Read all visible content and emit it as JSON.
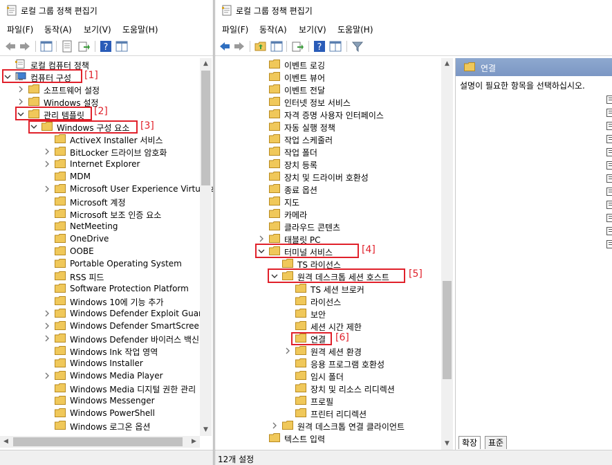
{
  "left_window": {
    "title": "로컬 그룹 정책 편집기",
    "menu": [
      "파일(F)",
      "동작(A)",
      "보기(V)",
      "도움말(H)"
    ],
    "tree": [
      {
        "label": "로컬 컴퓨터 정책",
        "level": 0,
        "arrow": "",
        "icon": "policy"
      },
      {
        "label": "컴퓨터 구성",
        "level": 0,
        "arrow": "down",
        "icon": "computer"
      },
      {
        "label": "소프트웨어 설정",
        "level": 1,
        "arrow": "right",
        "icon": "folder"
      },
      {
        "label": "Windows 설정",
        "level": 1,
        "arrow": "right",
        "icon": "folder"
      },
      {
        "label": "관리 템플릿",
        "level": 1,
        "arrow": "down",
        "icon": "folder"
      },
      {
        "label": "Windows 구성 요소",
        "level": 2,
        "arrow": "down",
        "icon": "folder"
      },
      {
        "label": "ActiveX Installer 서비스",
        "level": 3,
        "arrow": "",
        "icon": "folder"
      },
      {
        "label": "BitLocker 드라이브 암호화",
        "level": 3,
        "arrow": "right",
        "icon": "folder"
      },
      {
        "label": "Internet Explorer",
        "level": 3,
        "arrow": "right",
        "icon": "folder"
      },
      {
        "label": "MDM",
        "level": 3,
        "arrow": "",
        "icon": "folder"
      },
      {
        "label": "Microsoft User Experience Virtualiz",
        "level": 3,
        "arrow": "right",
        "icon": "folder"
      },
      {
        "label": "Microsoft 계정",
        "level": 3,
        "arrow": "",
        "icon": "folder"
      },
      {
        "label": "Microsoft 보조 인증 요소",
        "level": 3,
        "arrow": "",
        "icon": "folder"
      },
      {
        "label": "NetMeeting",
        "level": 3,
        "arrow": "",
        "icon": "folder"
      },
      {
        "label": "OneDrive",
        "level": 3,
        "arrow": "",
        "icon": "folder"
      },
      {
        "label": "OOBE",
        "level": 3,
        "arrow": "",
        "icon": "folder"
      },
      {
        "label": "Portable Operating System",
        "level": 3,
        "arrow": "",
        "icon": "folder"
      },
      {
        "label": "RSS 피드",
        "level": 3,
        "arrow": "",
        "icon": "folder"
      },
      {
        "label": "Software Protection Platform",
        "level": 3,
        "arrow": "",
        "icon": "folder"
      },
      {
        "label": "Windows 10에 기능 추가",
        "level": 3,
        "arrow": "",
        "icon": "folder"
      },
      {
        "label": "Windows Defender Exploit Guard",
        "level": 3,
        "arrow": "right",
        "icon": "folder"
      },
      {
        "label": "Windows Defender SmartScreen",
        "level": 3,
        "arrow": "right",
        "icon": "folder"
      },
      {
        "label": "Windows Defender 바이러스 백신",
        "level": 3,
        "arrow": "right",
        "icon": "folder"
      },
      {
        "label": "Windows Ink 작업 영역",
        "level": 3,
        "arrow": "",
        "icon": "folder"
      },
      {
        "label": "Windows Installer",
        "level": 3,
        "arrow": "",
        "icon": "folder"
      },
      {
        "label": "Windows Media Player",
        "level": 3,
        "arrow": "right",
        "icon": "folder"
      },
      {
        "label": "Windows Media 디지털 권한 관리",
        "level": 3,
        "arrow": "",
        "icon": "folder"
      },
      {
        "label": "Windows Messenger",
        "level": 3,
        "arrow": "",
        "icon": "folder"
      },
      {
        "label": "Windows PowerShell",
        "level": 3,
        "arrow": "",
        "icon": "folder"
      },
      {
        "label": "Windows 로그온 옵션",
        "level": 3,
        "arrow": "",
        "icon": "folder"
      }
    ],
    "markers": [
      "[1]",
      "[2]",
      "[3]"
    ]
  },
  "right_window": {
    "title": "로컬 그룹 정책 편집기",
    "menu": [
      "파일(F)",
      "동작(A)",
      "보기(V)",
      "도움말(H)"
    ],
    "tree": [
      {
        "label": "이벤트 로깅",
        "level": 0,
        "arrow": ""
      },
      {
        "label": "이벤트 뷰어",
        "level": 0,
        "arrow": ""
      },
      {
        "label": "이벤트 전달",
        "level": 0,
        "arrow": ""
      },
      {
        "label": "인터넷 정보 서비스",
        "level": 0,
        "arrow": ""
      },
      {
        "label": "자격 증명 사용자 인터페이스",
        "level": 0,
        "arrow": ""
      },
      {
        "label": "자동 실행 정책",
        "level": 0,
        "arrow": ""
      },
      {
        "label": "작업 스케줄러",
        "level": 0,
        "arrow": ""
      },
      {
        "label": "작업 폴더",
        "level": 0,
        "arrow": ""
      },
      {
        "label": "장치 등록",
        "level": 0,
        "arrow": ""
      },
      {
        "label": "장치 및 드라이버 호환성",
        "level": 0,
        "arrow": ""
      },
      {
        "label": "종료 옵션",
        "level": 0,
        "arrow": ""
      },
      {
        "label": "지도",
        "level": 0,
        "arrow": ""
      },
      {
        "label": "카메라",
        "level": 0,
        "arrow": ""
      },
      {
        "label": "클라우드 콘텐츠",
        "level": 0,
        "arrow": ""
      },
      {
        "label": "태블릿 PC",
        "level": 0,
        "arrow": "right"
      },
      {
        "label": "터미널 서비스",
        "level": 0,
        "arrow": "down"
      },
      {
        "label": "TS 라이선스",
        "level": 1,
        "arrow": ""
      },
      {
        "label": "원격 데스크톱 세션 호스트",
        "level": 1,
        "arrow": "down"
      },
      {
        "label": "TS 세션 브로커",
        "level": 2,
        "arrow": ""
      },
      {
        "label": "라이선스",
        "level": 2,
        "arrow": ""
      },
      {
        "label": "보안",
        "level": 2,
        "arrow": ""
      },
      {
        "label": "세션 시간 제한",
        "level": 2,
        "arrow": ""
      },
      {
        "label": "연결",
        "level": 2,
        "arrow": ""
      },
      {
        "label": "원격 세션 환경",
        "level": 2,
        "arrow": "right"
      },
      {
        "label": "응용 프로그램 호환성",
        "level": 2,
        "arrow": ""
      },
      {
        "label": "임시 폴더",
        "level": 2,
        "arrow": ""
      },
      {
        "label": "장치 및 리소스 리디렉션",
        "level": 2,
        "arrow": ""
      },
      {
        "label": "프로필",
        "level": 2,
        "arrow": ""
      },
      {
        "label": "프린터 리디렉션",
        "level": 2,
        "arrow": ""
      },
      {
        "label": "원격 데스크톱 연결 클라이언트",
        "level": 1,
        "arrow": "right"
      },
      {
        "label": "텍스트 입력",
        "level": 0,
        "arrow": ""
      }
    ],
    "markers": [
      "[4]",
      "[5]",
      "[6]"
    ],
    "detail": {
      "header": "연결",
      "description": "설명이 필요한 항목을 선택하십시오."
    },
    "tabs": [
      "확장",
      "표준"
    ],
    "status": "12개 설정"
  },
  "colors": {
    "highlight": "#e0202a",
    "folder": "#f0c85a",
    "header_bg": "#8ea8cf"
  }
}
